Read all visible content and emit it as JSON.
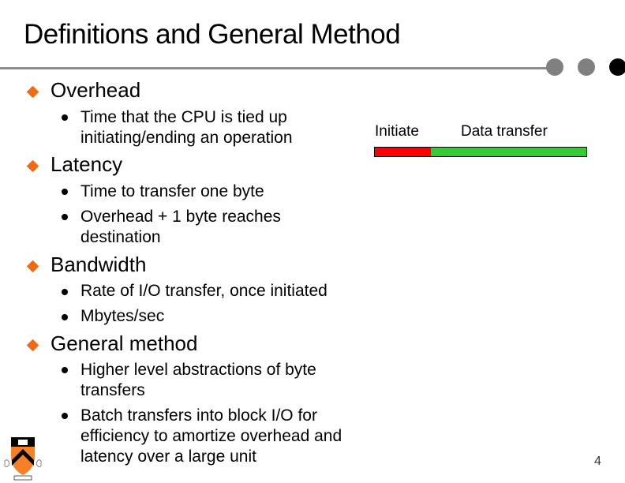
{
  "slide": {
    "title": "Definitions and General Method",
    "page_number": "4"
  },
  "sections": [
    {
      "heading": "Overhead",
      "items": [
        "Time that the CPU is tied up initiating/ending an operation"
      ]
    },
    {
      "heading": "Latency",
      "items": [
        "Time to transfer one byte",
        "Overhead + 1 byte reaches destination"
      ]
    },
    {
      "heading": "Bandwidth",
      "items": [
        "Rate of I/O transfer, once initiated",
        "Mbytes/sec"
      ]
    },
    {
      "heading": "General method",
      "items": [
        "Higher level abstractions of byte transfers",
        "Batch transfers into block I/O for efficiency to amortize overhead and latency over a large unit"
      ]
    }
  ],
  "diagram": {
    "initiate_label": "Initiate",
    "transfer_label": "Data transfer",
    "initiate_color": "#ff0000",
    "transfer_color": "#33cc33"
  },
  "colors": {
    "accent_diamond": "#f06a14",
    "rule": "#8c8c8c"
  },
  "logo": {
    "name": "princeton-shield"
  }
}
